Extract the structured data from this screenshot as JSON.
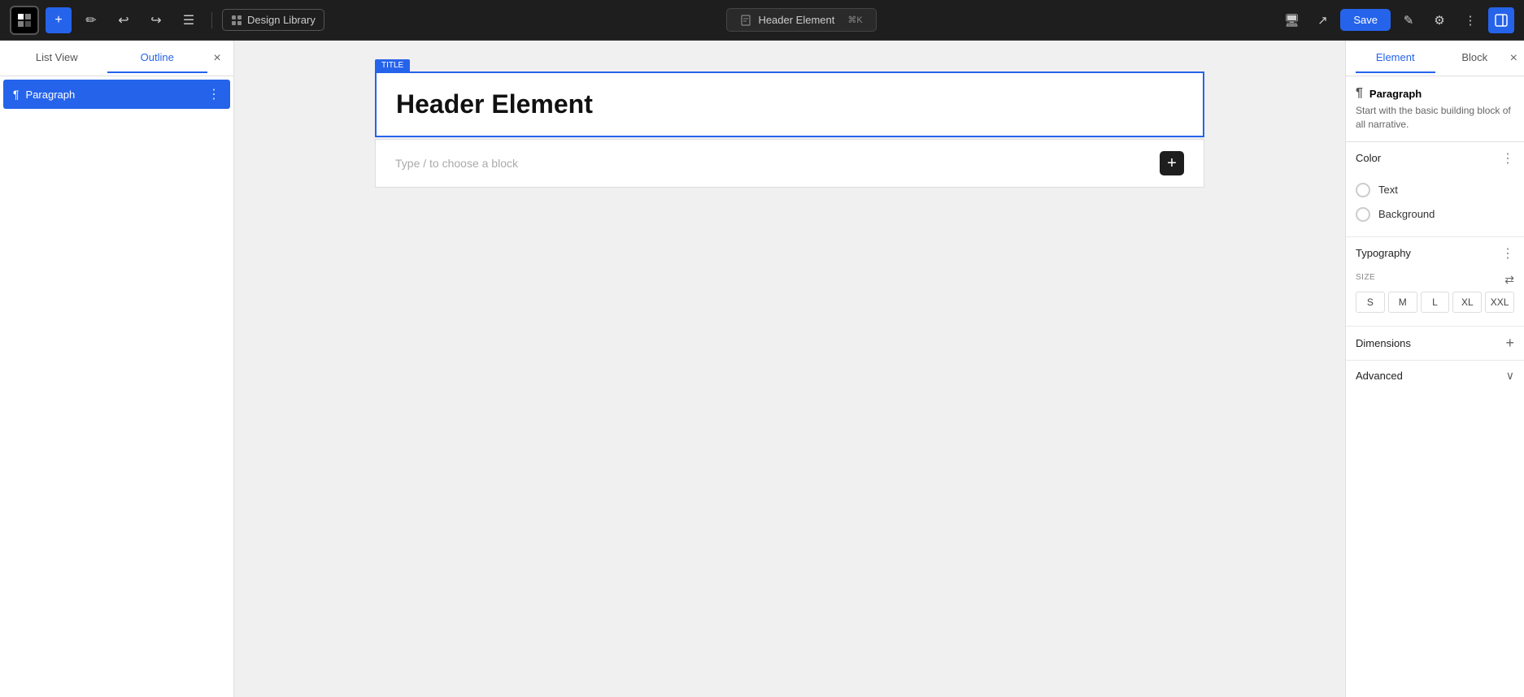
{
  "toolbar": {
    "logo_icon": "W",
    "add_icon": "+",
    "edit_icon": "✏",
    "undo_icon": "↩",
    "redo_icon": "↪",
    "menu_icon": "☰",
    "design_library_label": "Design Library",
    "header_element_label": "Header Element",
    "shortcut": "⌘K",
    "save_label": "Save",
    "preview_icon": "⬜",
    "external_icon": "⬡",
    "more_icon": "⋮",
    "sidebar_icon": "▣"
  },
  "left_panel": {
    "tab_list_view": "List View",
    "tab_outline": "Outline",
    "close_icon": "×",
    "item": {
      "icon": "¶",
      "label": "Paragraph",
      "more_icon": "⋮"
    }
  },
  "canvas": {
    "title_tag": "TITLE",
    "header_text": "Header Element",
    "placeholder": "Type / to choose a block",
    "add_icon": "+"
  },
  "right_panel": {
    "tab_element": "Element",
    "tab_block": "Block",
    "close_icon": "×",
    "block_icon": "¶",
    "block_name": "Paragraph",
    "block_desc": "Start with the basic building block of all narrative.",
    "color_section_title": "Color",
    "color_more_icon": "⋮",
    "text_label": "Text",
    "background_label": "Background",
    "typography_section_title": "Typography",
    "typography_more_icon": "⋮",
    "size_label": "SIZE",
    "resize_icon": "⇄",
    "sizes": [
      "S",
      "M",
      "L",
      "XL",
      "XXL"
    ],
    "dimensions_title": "Dimensions",
    "dimensions_add_icon": "+",
    "advanced_title": "Advanced",
    "advanced_chevron": "∨"
  }
}
